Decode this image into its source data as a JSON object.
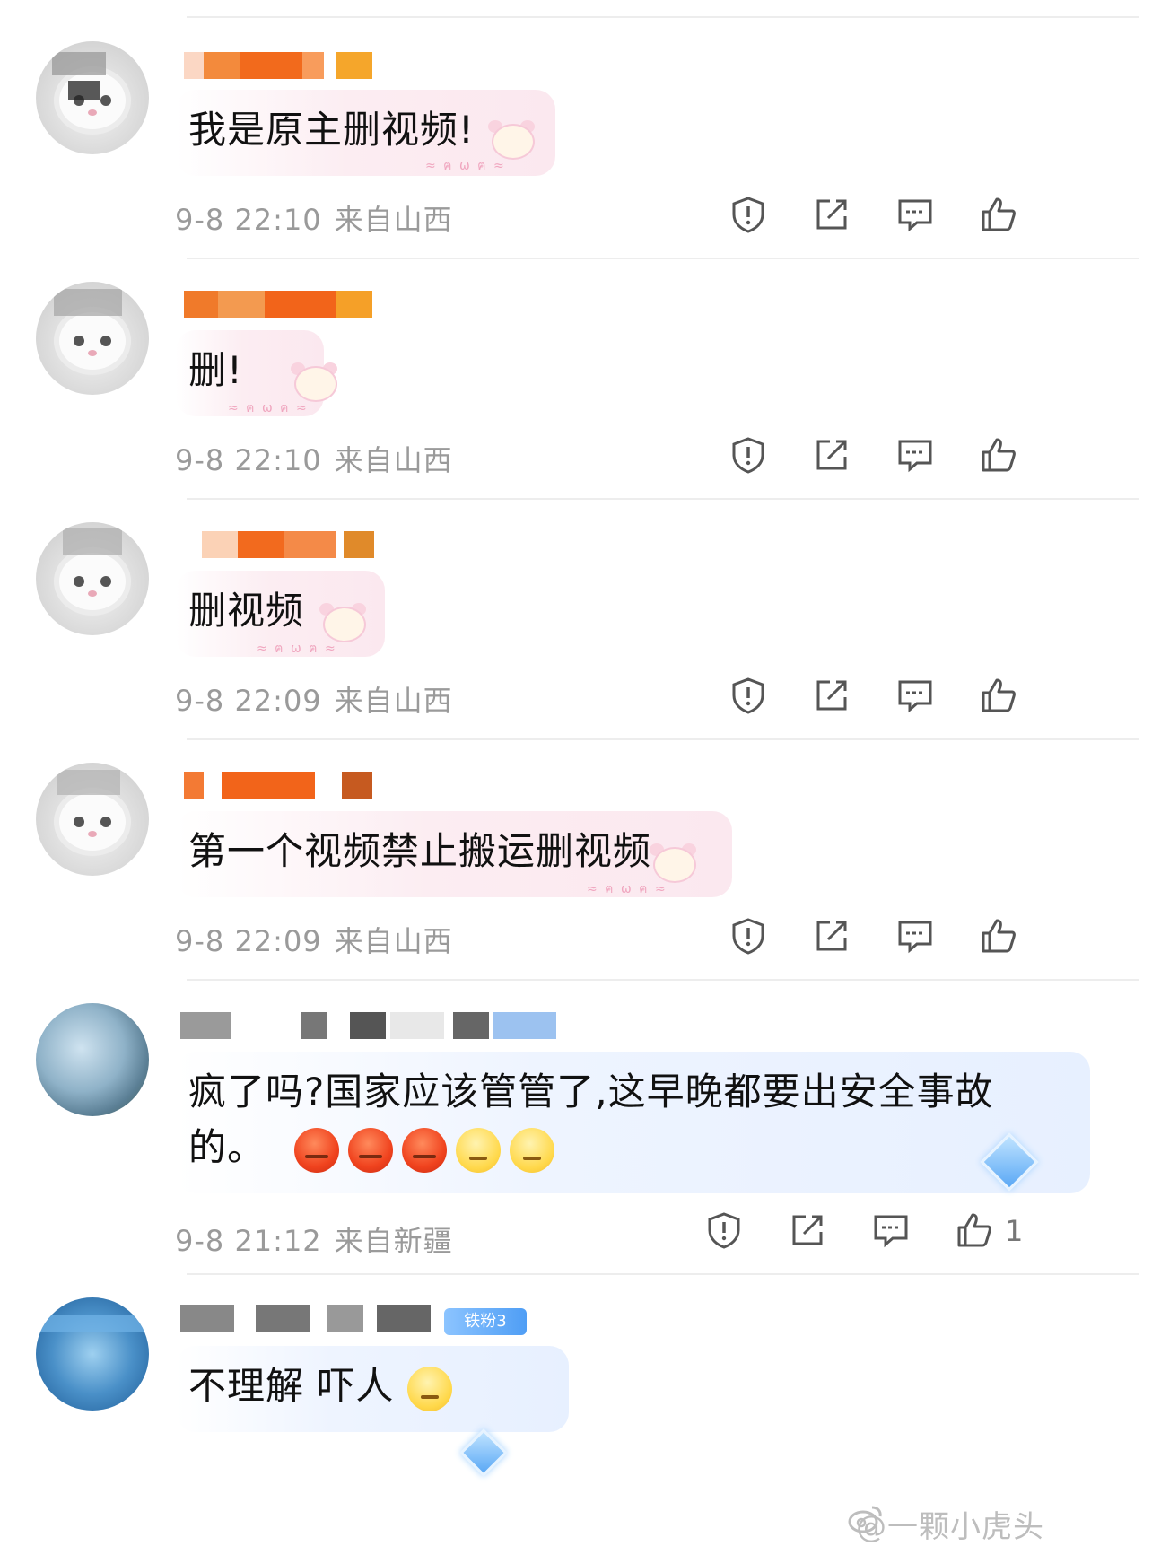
{
  "comments": [
    {
      "text": "我是原主删视频!",
      "date": "9-8 22:10",
      "location": "来自山西",
      "likes": ""
    },
    {
      "text": "删!",
      "date": "9-8 22:10",
      "location": "来自山西",
      "likes": ""
    },
    {
      "text": "删视频",
      "date": "9-8 22:09",
      "location": "来自山西",
      "likes": ""
    },
    {
      "text": "第一个视频禁止搬运删视频",
      "date": "9-8 22:09",
      "location": "来自山西",
      "likes": ""
    },
    {
      "text_line1": "疯了吗?国家应该管管了,这早晚都要出安全事故",
      "text_line2": "的。",
      "date": "9-8 21:12",
      "location": "来自新疆",
      "likes": "1"
    },
    {
      "text": "不理解 吓人",
      "badge": "铁粉3"
    }
  ],
  "watermark": "@一颗小虎头",
  "icons": [
    "report-icon",
    "share-icon",
    "reply-icon",
    "like-icon"
  ]
}
